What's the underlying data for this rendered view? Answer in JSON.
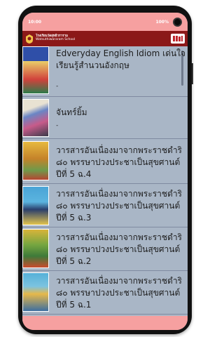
{
  "status": {
    "time": "10:00",
    "battery": "100%"
  },
  "header": {
    "school_th": "โรงเรียนวัดสุทธิวราราม",
    "school_en": "Watsuthiwararam School"
  },
  "books": [
    {
      "title": "Edveryday English Idiom  เด่นใจ เรียนรู้สำนวนอังกฤษ",
      "sub": "-"
    },
    {
      "title": "จันทร์ยิ้ม",
      "sub": "-"
    },
    {
      "title": "วารสารอันเนื่องมาจากพระราชดำริ ๘๐ พรรษาปวงประชาเป็นสุขศานต์ ปีที่ 5 ฉ.4",
      "sub": "-"
    },
    {
      "title": "วารสารอันเนื่องมาจากพระราชดำริ ๘๐ พรรษาปวงประชาเป็นสุขศานต์ ปีที่ 5 ฉ.3",
      "sub": "-"
    },
    {
      "title": "วารสารอันเนื่องมาจากพระราชดำริ ๘๐ พรรษาปวงประชาเป็นสุขศานต์ ปีที่ 5 ฉ.2",
      "sub": "-"
    },
    {
      "title": "วารสารอันเนื่องมาจากพระราชดำริ ๘๐ พรรษาปวงประชาเป็นสุขศานต์ ปีที่ 5 ฉ.1",
      "sub": "-"
    },
    {
      "title": "",
      "sub": ""
    }
  ],
  "colors": {
    "appbar": "#8b1818",
    "statusbar": "#f6a0a0",
    "list_bg": "#a9b6c6"
  }
}
